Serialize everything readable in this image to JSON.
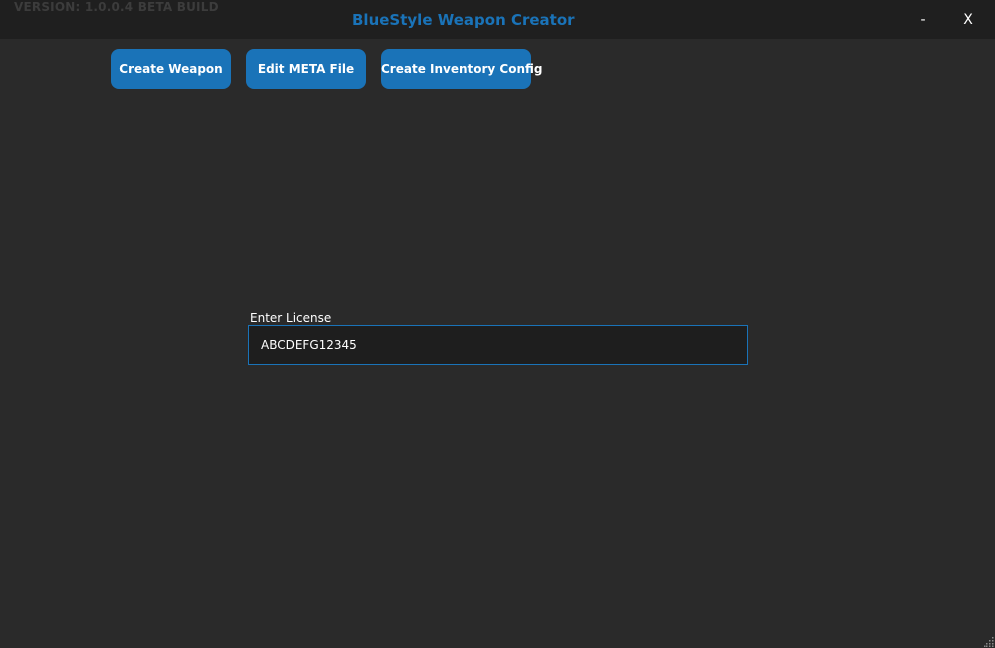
{
  "titlebar": {
    "version": "VERSION: 1.0.0.4 BETA BUILD",
    "title": "BlueStyle Weapon Creator",
    "minimize_label": "-",
    "close_label": "X"
  },
  "nav": {
    "create_weapon_label": "Create Weapon",
    "edit_meta_label": "Edit META File",
    "create_inventory_label": "Create Inventory Config"
  },
  "license": {
    "label": "Enter License",
    "value": "ABCDEFG12345"
  },
  "colors": {
    "accent": "#1a73b8",
    "background": "#2a2a2a",
    "titlebar": "#1f1f1f",
    "input_background": "#1e1e1e"
  }
}
